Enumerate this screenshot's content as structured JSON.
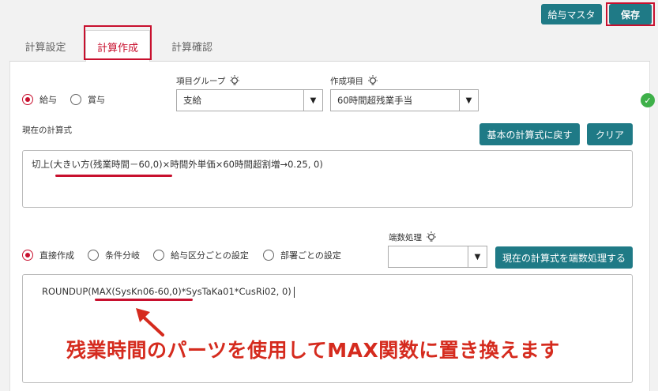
{
  "header": {
    "master_label": "給与マスタ",
    "save_label": "保存"
  },
  "tabs": [
    {
      "label": "計算設定"
    },
    {
      "label": "計算作成"
    },
    {
      "label": "計算確認"
    }
  ],
  "pay_type": {
    "salary": "給与",
    "bonus": "賞与"
  },
  "item_group": {
    "label": "項目グループ",
    "value": "支給"
  },
  "create_item": {
    "label": "作成項目",
    "value": "60時間超残業手当"
  },
  "current_formula": {
    "label": "現在の計算式",
    "reset_label": "基本の計算式に戻す",
    "clear_label": "クリア",
    "text_a": "切上(",
    "text_b": "大きい方(残業時間－60,0)",
    "text_c": "×時間外単価×60時間超割増→0.25, 0)"
  },
  "mode": {
    "direct": "直接作成",
    "conditional": "条件分岐",
    "by_pay_class": "給与区分ごとの設定",
    "by_department": "部署ごとの設定"
  },
  "rounding": {
    "label": "端数処理",
    "value": "",
    "apply_label": "現在の計算式を端数処理する"
  },
  "code_formula": {
    "text_a": "ROUNDUP(",
    "text_b": "MAX(SysKn06-60,0)",
    "text_c": "*SysTaKa01*CusRi02, 0)"
  },
  "annotation": "残業時間のパーツを使用してMAX関数に置き換えます",
  "colors": {
    "accent": "#1f7a86",
    "highlight": "#c8102e",
    "ok": "#3eb049"
  }
}
